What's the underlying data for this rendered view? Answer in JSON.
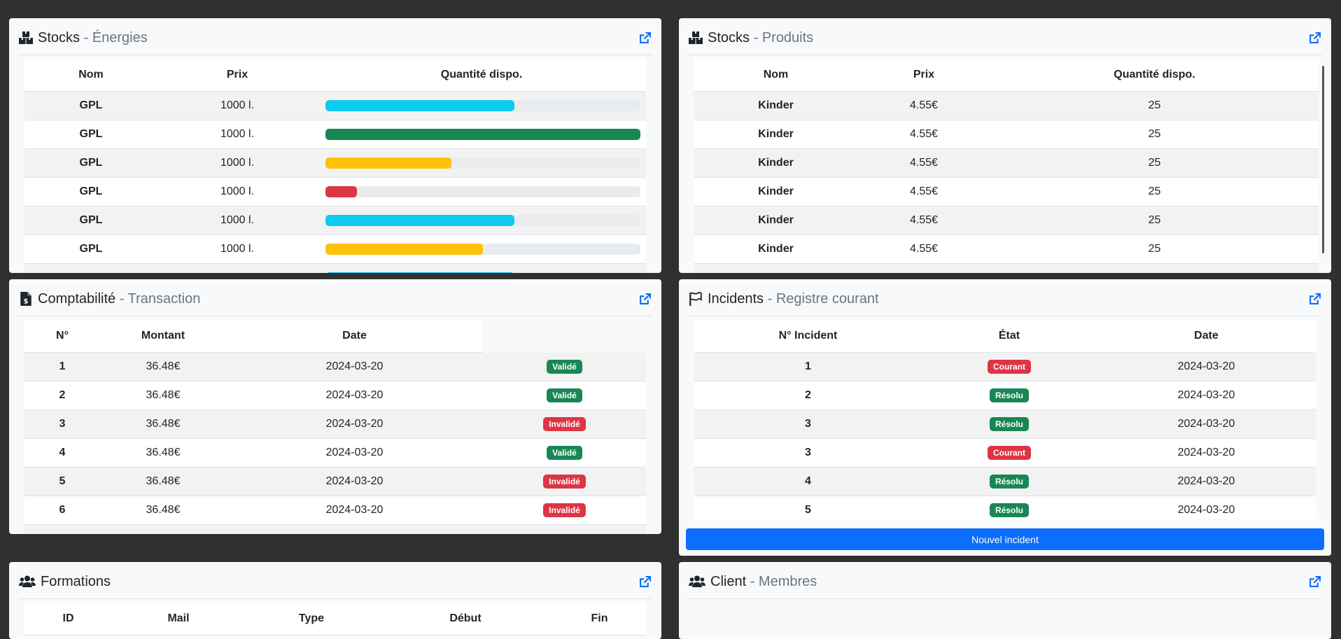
{
  "colors": {
    "info": "#0dcaf0",
    "success": "#198754",
    "warning": "#ffc107",
    "danger": "#dc3545",
    "primary": "#0d6efd"
  },
  "energies": {
    "icon": "boxes-icon",
    "title": "Stocks",
    "sep": " - ",
    "subtitle": "Énergies",
    "headers": [
      "Nom",
      "Prix",
      "Quantité dispo."
    ],
    "rows": [
      {
        "nom": "GPL",
        "prix": "1000 l.",
        "level": 0.6,
        "color": "#0dcaf0"
      },
      {
        "nom": "GPL",
        "prix": "1000 l.",
        "level": 1.0,
        "color": "#198754"
      },
      {
        "nom": "GPL",
        "prix": "1000 l.",
        "level": 0.4,
        "color": "#ffc107"
      },
      {
        "nom": "GPL",
        "prix": "1000 l.",
        "level": 0.1,
        "color": "#dc3545"
      },
      {
        "nom": "GPL",
        "prix": "1000 l.",
        "level": 0.6,
        "color": "#0dcaf0"
      },
      {
        "nom": "GPL",
        "prix": "1000 l.",
        "level": 0.5,
        "color": "#ffc107"
      },
      {
        "nom": "",
        "prix": "",
        "level": 0.6,
        "color": "#0dcaf0"
      }
    ]
  },
  "produits": {
    "icon": "boxes-icon",
    "title": "Stocks",
    "sep": " - ",
    "subtitle": "Produits",
    "headers": [
      "Nom",
      "Prix",
      "Quantité dispo."
    ],
    "rows": [
      {
        "nom": "Kinder",
        "prix": "4.55€",
        "qte": "25"
      },
      {
        "nom": "Kinder",
        "prix": "4.55€",
        "qte": "25"
      },
      {
        "nom": "Kinder",
        "prix": "4.55€",
        "qte": "25"
      },
      {
        "nom": "Kinder",
        "prix": "4.55€",
        "qte": "25"
      },
      {
        "nom": "Kinder",
        "prix": "4.55€",
        "qte": "25"
      },
      {
        "nom": "Kinder",
        "prix": "4.55€",
        "qte": "25"
      },
      {
        "nom": "",
        "prix": "",
        "qte": ""
      }
    ]
  },
  "compta": {
    "icon": "invoice-dollar-icon",
    "title": "Comptabilité",
    "sep": " - ",
    "subtitle": "Transaction",
    "headers": [
      "N°",
      "Montant",
      "Date",
      ""
    ],
    "rows": [
      {
        "n": "1",
        "montant": "36.48€",
        "date": "2024-03-20",
        "status": "Validé",
        "color": "#198754"
      },
      {
        "n": "2",
        "montant": "36.48€",
        "date": "2024-03-20",
        "status": "Validé",
        "color": "#198754"
      },
      {
        "n": "3",
        "montant": "36.48€",
        "date": "2024-03-20",
        "status": "Invalidé",
        "color": "#dc3545"
      },
      {
        "n": "4",
        "montant": "36.48€",
        "date": "2024-03-20",
        "status": "Validé",
        "color": "#198754"
      },
      {
        "n": "5",
        "montant": "36.48€",
        "date": "2024-03-20",
        "status": "Invalidé",
        "color": "#dc3545"
      },
      {
        "n": "6",
        "montant": "36.48€",
        "date": "2024-03-20",
        "status": "Invalidé",
        "color": "#dc3545"
      },
      {
        "n": "",
        "montant": "",
        "date": "",
        "status": "",
        "color": "#198754"
      }
    ]
  },
  "incidents": {
    "icon": "flag-icon",
    "title": "Incidents",
    "sep": " - ",
    "subtitle": "Registre courant",
    "headers": [
      "N° Incident",
      "État",
      "Date"
    ],
    "rows": [
      {
        "n": "1",
        "etat": "Courant",
        "color": "#dc3545",
        "date": "2024-03-20"
      },
      {
        "n": "2",
        "etat": "Résolu",
        "color": "#198754",
        "date": "2024-03-20"
      },
      {
        "n": "3",
        "etat": "Résolu",
        "color": "#198754",
        "date": "2024-03-20"
      },
      {
        "n": "3",
        "etat": "Courant",
        "color": "#dc3545",
        "date": "2024-03-20"
      },
      {
        "n": "4",
        "etat": "Résolu",
        "color": "#198754",
        "date": "2024-03-20"
      },
      {
        "n": "5",
        "etat": "Résolu",
        "color": "#198754",
        "date": "2024-03-20"
      },
      {
        "n": "",
        "etat": "",
        "color": "#198754",
        "date": ""
      }
    ],
    "button": "Nouvel incident"
  },
  "formations": {
    "icon": "users-icon",
    "title": "Formations",
    "headers": [
      "ID",
      "Mail",
      "Type",
      "Début",
      "Fin"
    ]
  },
  "client": {
    "icon": "users-icon",
    "title": "Client",
    "sep": " - ",
    "subtitle": "Membres"
  }
}
